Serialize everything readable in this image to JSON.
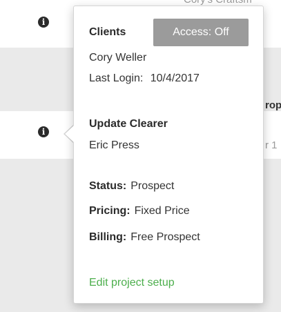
{
  "background": {
    "top_truncated_text": "Cory's Craftsm",
    "right_text_1": "rop",
    "right_text_2": "r 1"
  },
  "popover": {
    "section1_heading": "Clients",
    "access_button": "Access: Off",
    "client_name": "Cory Weller",
    "last_login_label": "Last Login:",
    "last_login_value": "10/4/2017",
    "section2_heading": "Update Clearer",
    "clearer_name": "Eric Press",
    "status_label": "Status:",
    "status_value": "Prospect",
    "pricing_label": "Pricing:",
    "pricing_value": "Fixed Price",
    "billing_label": "Billing:",
    "billing_value": "Free Prospect",
    "edit_link": "Edit project setup"
  },
  "colors": {
    "link": "#4cae4c",
    "access_button_bg": "#9b9b9b"
  },
  "icons": [
    "info-icon",
    "info-icon"
  ]
}
